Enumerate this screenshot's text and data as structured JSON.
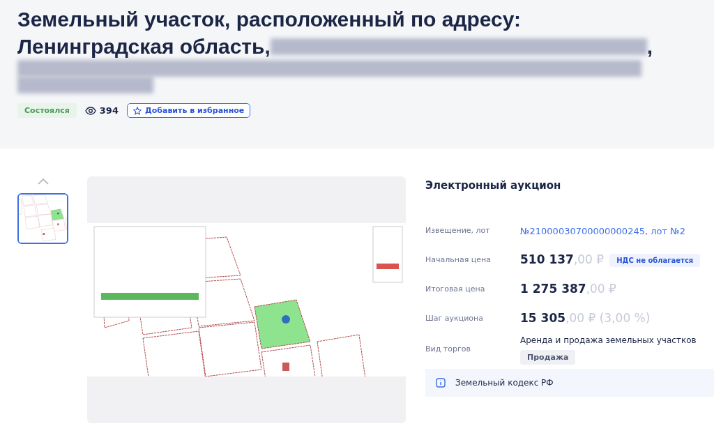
{
  "title": {
    "line_1": "Земельный участок, расположенный по адресу:",
    "line_2_start": "Ленинградская область,",
    "line_2_end": ","
  },
  "status": {
    "label": "Состоялся"
  },
  "views": "394",
  "favorite_button": "Добавить в избранное",
  "gallery": {
    "thumbnails": [
      {
        "kind": "picture",
        "selected": true
      }
    ],
    "main": {
      "kind": "picture"
    }
  },
  "auction": {
    "heading": "Электронный аукцион",
    "rows": [
      {
        "kind": "link",
        "label": "Извещение, лот",
        "value": "№21000030700000000245, лот №2"
      },
      {
        "kind": "price",
        "label": "Начальная цена",
        "whole": "510 137",
        "rest": ",00 ₽",
        "badge": "НДС не облагается"
      },
      {
        "kind": "price",
        "label": "Итоговая цена",
        "whole": "1 275 387",
        "rest": ",00 ₽"
      },
      {
        "kind": "price",
        "label": "Шаг аукциона",
        "whole": "15 305",
        "rest": ",00 ₽ (3,00 %)"
      },
      {
        "kind": "text",
        "label": "Вид торгов",
        "value": "Аренда и продажа земельных участков",
        "tag": "Продажа"
      }
    ],
    "notice": "Земельный кодекс РФ"
  }
}
